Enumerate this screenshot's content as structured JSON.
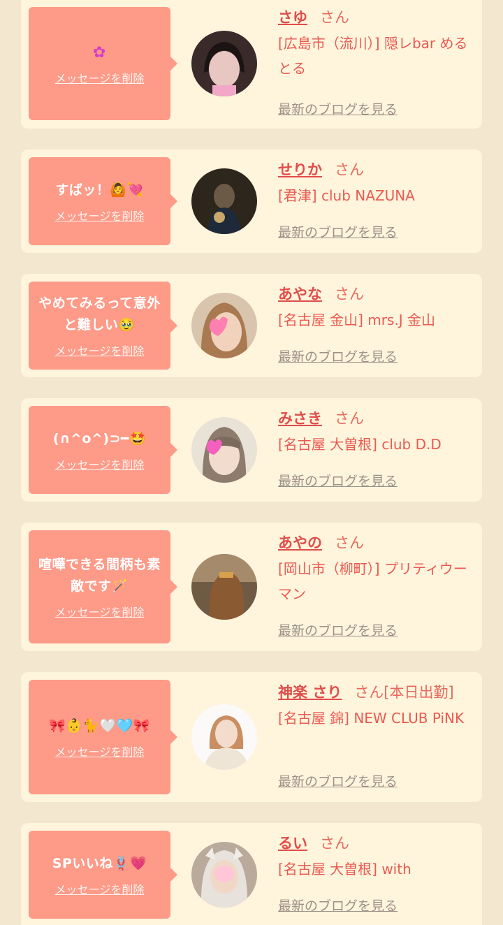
{
  "colors": {
    "page_bg": "#f3e7cf",
    "card_bg": "#fff4dc",
    "bubble_bg": "#fd9a88",
    "name_color": "#e04d4a",
    "link_gray": "#9c9189"
  },
  "common": {
    "delete_label": "メッセージを削除",
    "blog_label": "最新のブログを見る",
    "san": "さん"
  },
  "items": [
    {
      "message": "✿",
      "name": "さゆ",
      "suffix": "さん",
      "shop": "[広島市（流川）] 隠レbar めるとる"
    },
    {
      "message": "すばッ！🙆💘",
      "name": "せりか",
      "suffix": "さん",
      "shop": "[君津] club NAZUNA"
    },
    {
      "message": "やめてみるって意外と難しい🥹",
      "name": "あやな",
      "suffix": "さん",
      "shop": "[名古屋 金山] mrs.J 金山"
    },
    {
      "message": "(∩^o^)⊃━🤩",
      "name": "みさき",
      "suffix": "さん",
      "shop": "[名古屋 大曽根] club D.D"
    },
    {
      "message": "喧嘩できる間柄も素敵です🪄",
      "name": "あやの",
      "suffix": "さん",
      "shop": "[岡山市（柳町）] プリティウーマン"
    },
    {
      "message": "🎀👶🐈🤍🩵🎀",
      "name": "神楽 さり",
      "suffix": "さん[本日出勤]",
      "shop": "[名古屋 錦] NEW CLUB PiNK"
    },
    {
      "message": "SPいいね🪢💗",
      "name": "るい",
      "suffix": "さん",
      "shop": "[名古屋 大曽根] with"
    }
  ]
}
